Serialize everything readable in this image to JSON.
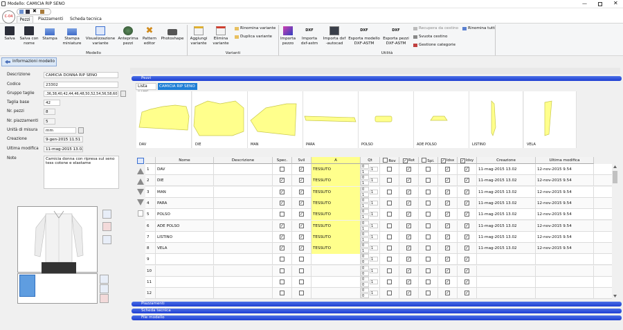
{
  "title": "Modello: CAMICIA RIP SENO",
  "logo_text": "C-04",
  "tabs": [
    "Pezzi",
    "Piazzamenti",
    "Scheda tecnica"
  ],
  "ribbon": {
    "modello": {
      "label": "Modello",
      "buttons": [
        "Salva",
        "Salva con nome",
        "Stampa",
        "Stampa miniature",
        "Visualizzazione variante",
        "Anteprima pezzi",
        "Pattern editor",
        "Photoshape"
      ]
    },
    "varianti": {
      "label": "Varianti",
      "buttons": [
        "Aggiungi variante",
        "Elimina variante"
      ],
      "small": [
        "Rinomina variante",
        "Duplica variante"
      ]
    },
    "utilita": {
      "label": "Utilità",
      "buttons": [
        "Importa pezzo",
        "Importa dxf-astm",
        "Importa dxf -autocad",
        "Esporta modello DXF-ASTM",
        "Esporta pezzi DXF-ASTM"
      ],
      "small": [
        "Recupera da cestino",
        "Svuota cestino",
        "Gestione categorie",
        "Rinomina tutti"
      ]
    }
  },
  "info_tab": "Informazioni modello",
  "info": {
    "descrizione_label": "Descrizione",
    "descrizione": "CAMICIA DONNA RIP SENO",
    "codice_label": "Codice",
    "codice": "23302",
    "gruppo_label": "Gruppo taglie",
    "gruppo": ",36,38,40,42,44,46,48,50,52,54,56,58,60",
    "taglia_label": "Taglia base",
    "taglia": "42",
    "npezzi_label": "Nr. pezzi",
    "npezzi": "8",
    "npiazz_label": "Nr. piazzamenti",
    "npiazz": "5",
    "unita_label": "Unità di misura",
    "unita": "mm",
    "creazione_label": "Creazione",
    "creazione": "9-gen-2015 11.51",
    "ultima_label": "Ultima modifica",
    "ultima": "11-mag-2015 13.02",
    "note_label": "Note",
    "note": "Camicia donna con ripresa sul seno tess cotone e elastame"
  },
  "sections": {
    "pezzi": "Pezzi",
    "piazzamenti": "Piazzamenti",
    "scheda": "Scheda tecnica",
    "file": "File modello"
  },
  "lista_pezzi": "Lista pezzi",
  "variant_tab": "CAMICIA RIP SENO",
  "shapes": [
    "DAV",
    "DIE",
    "MAN",
    "PARA",
    "POLSO",
    "ADE POLSO",
    "LISTINO",
    "VELA"
  ],
  "columns": [
    "Nome",
    "Descrizione",
    "Spec.",
    "Svil",
    "A",
    "Qt",
    "Rov",
    "Rot",
    "Spi.",
    "Idsx",
    "Idsy",
    "Creazione",
    "Ultima modifica"
  ],
  "colors": {
    "accent": "#2a4fdc",
    "tessuto": "#ffff8c",
    "selected_tab": "#1f7fd6"
  },
  "rows": [
    {
      "n": "1",
      "nome": "DAV",
      "a": "TESSUTO",
      "qt": [
        "0",
        "1",
        "1"
      ],
      "spec": false,
      "svil": true,
      "rov": false,
      "rot": true,
      "spi": false,
      "idsx": true,
      "idsy": true,
      "creazione": "11-mag-2015 13.02",
      "ultima": "12-nov-2015 9.54"
    },
    {
      "n": "2",
      "nome": "DIE",
      "a": "TESSUTO",
      "qt": [
        "0",
        "1",
        "1"
      ],
      "spec": true,
      "svil": true,
      "rov": false,
      "rot": true,
      "spi": false,
      "idsx": true,
      "idsy": true,
      "creazione": "11-mag-2015 13.02",
      "ultima": "12-nov-2015 9.54"
    },
    {
      "n": "3",
      "nome": "MAN",
      "a": "TESSUTO",
      "qt": [
        "0",
        "1",
        "1"
      ],
      "spec": true,
      "svil": true,
      "rov": false,
      "rot": true,
      "spi": false,
      "idsx": true,
      "idsy": true,
      "creazione": "11-mag-2015 13.02",
      "ultima": "12-nov-2015 9.54"
    },
    {
      "n": "4",
      "nome": "PARA",
      "a": "TESSUTO",
      "qt": [
        "0",
        "1",
        "1"
      ],
      "spec": true,
      "svil": true,
      "rov": false,
      "rot": true,
      "spi": false,
      "idsx": true,
      "idsy": true,
      "creazione": "11-mag-2015 13.02",
      "ultima": "12-nov-2015 9.54"
    },
    {
      "n": "5",
      "nome": "POLSO",
      "a": "TESSUTO",
      "qt": [
        "0",
        "1",
        "1"
      ],
      "spec": false,
      "svil": true,
      "rov": false,
      "rot": true,
      "spi": false,
      "idsx": true,
      "idsy": true,
      "creazione": "11-mag-2015 13.02",
      "ultima": "12-nov-2015 9.54"
    },
    {
      "n": "6",
      "nome": "ADE POLSO",
      "a": "TESSUTO",
      "qt": [
        "0",
        "1",
        "1"
      ],
      "spec": true,
      "svil": true,
      "rov": false,
      "rot": true,
      "spi": false,
      "idsx": true,
      "idsy": true,
      "creazione": "11-mag-2015 13.02",
      "ultima": "12-nov-2015 9.54"
    },
    {
      "n": "7",
      "nome": "LISTINO",
      "a": "TESSUTO",
      "qt": [
        "0",
        "1",
        "1"
      ],
      "spec": true,
      "svil": true,
      "rov": false,
      "rot": true,
      "spi": false,
      "idsx": true,
      "idsy": true,
      "creazione": "11-mag-2015 13.02",
      "ultima": "12-nov-2015 9.54"
    },
    {
      "n": "8",
      "nome": "VELA",
      "a": "TESSUTO",
      "qt": [
        "0",
        "1",
        "1"
      ],
      "spec": true,
      "svil": true,
      "rov": false,
      "rot": true,
      "spi": false,
      "idsx": true,
      "idsy": true,
      "creazione": "11-mag-2015 13.02",
      "ultima": "12-nov-2015 9.54"
    },
    {
      "n": "9",
      "nome": "",
      "a": "",
      "qt": [
        "0",
        "1",
        "0"
      ],
      "spec": false,
      "svil": false,
      "rov": false,
      "rot": true,
      "spi": false,
      "idsx": true,
      "idsy": true,
      "creazione": "",
      "ultima": ""
    },
    {
      "n": "10",
      "nome": "",
      "a": "",
      "qt": [
        "0",
        "1",
        "0"
      ],
      "spec": false,
      "svil": false,
      "rov": false,
      "rot": true,
      "spi": false,
      "idsx": true,
      "idsy": true,
      "creazione": "",
      "ultima": ""
    },
    {
      "n": "11",
      "nome": "",
      "a": "",
      "qt": [
        "0",
        "1",
        "0"
      ],
      "spec": false,
      "svil": false,
      "rov": false,
      "rot": true,
      "spi": false,
      "idsx": true,
      "idsy": true,
      "creazione": "",
      "ultima": ""
    },
    {
      "n": "12",
      "nome": "",
      "a": "",
      "qt": [
        "0",
        "1",
        "0"
      ],
      "spec": false,
      "svil": false,
      "rov": false,
      "rot": true,
      "spi": false,
      "idsx": true,
      "idsy": true,
      "creazione": "",
      "ultima": ""
    }
  ]
}
